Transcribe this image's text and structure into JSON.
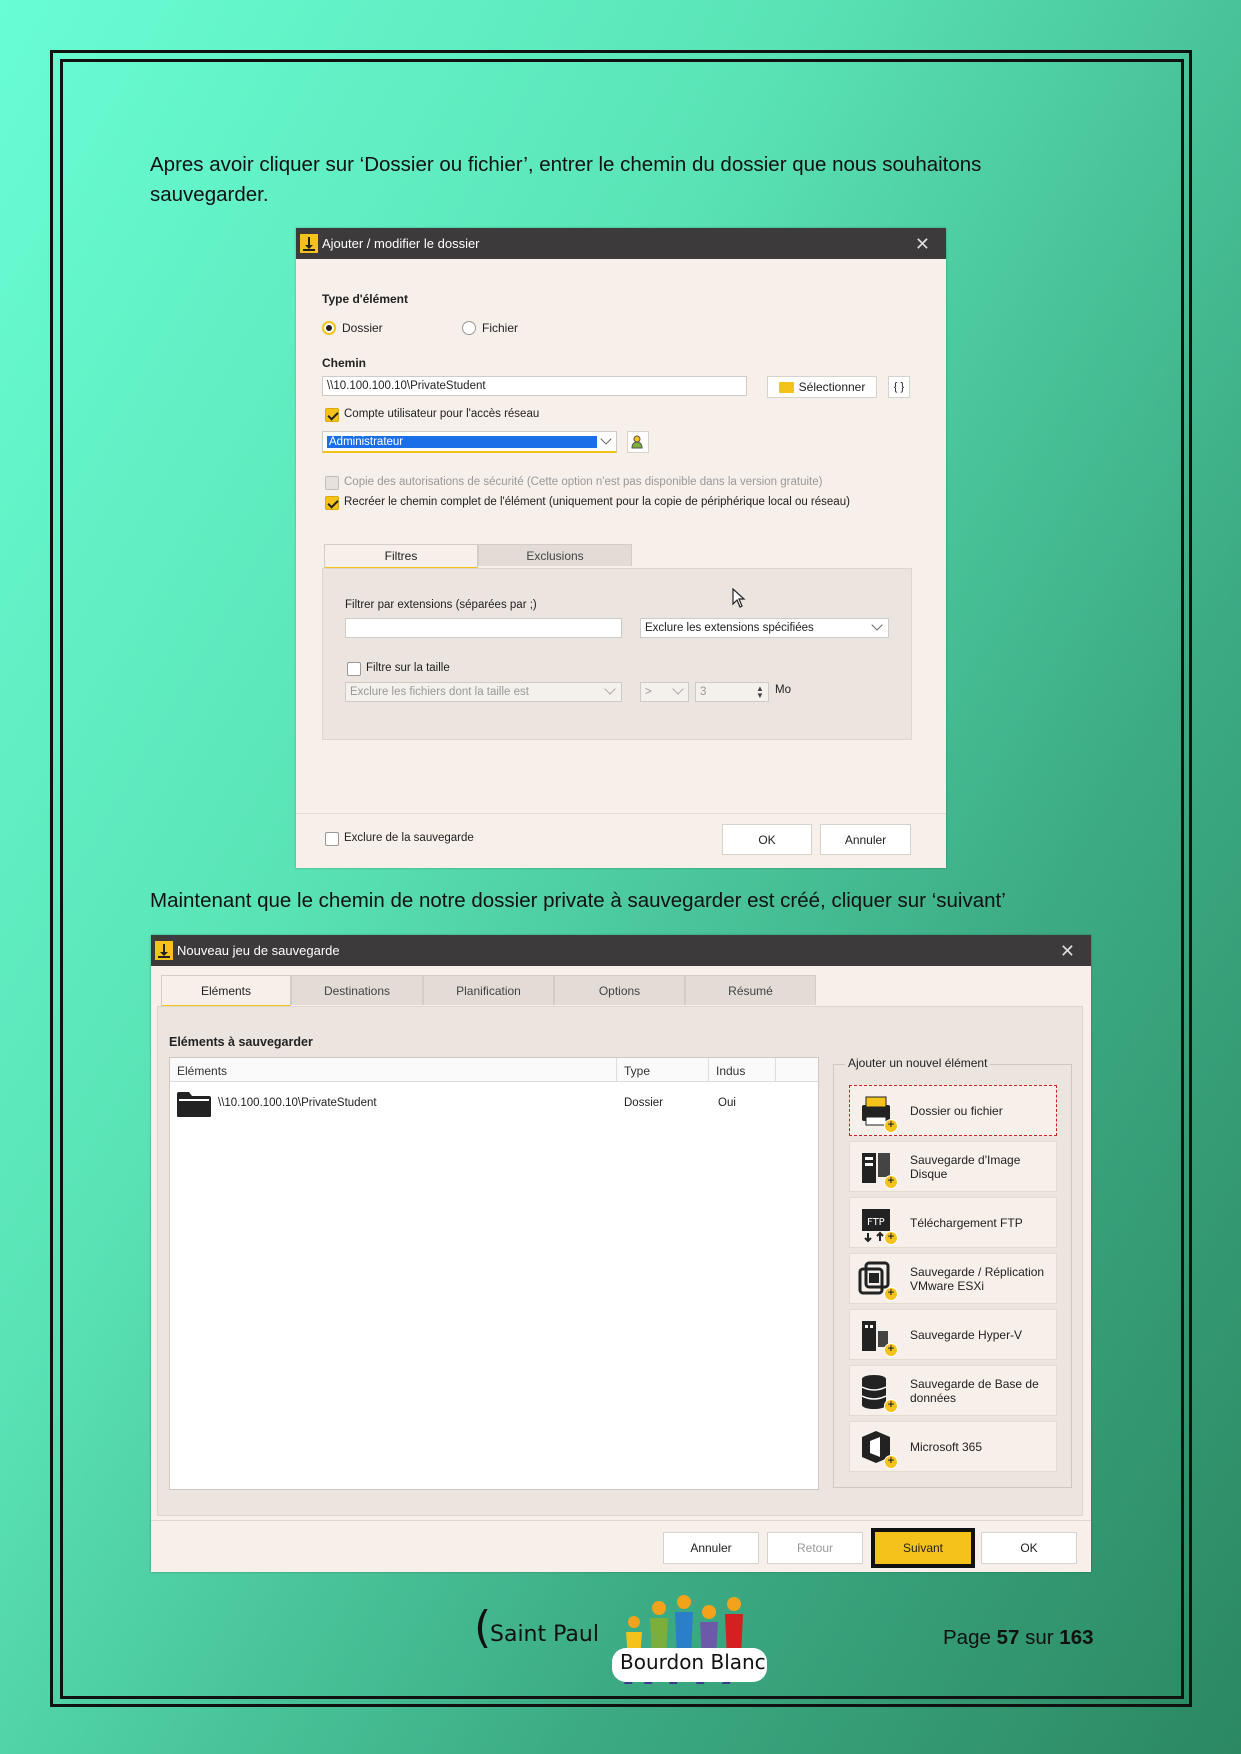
{
  "intro_text": "Apres avoir cliquer sur ‘Dossier ou fichier’, entrer le chemin du dossier que nous souhaitons sauvegarder.",
  "middle_text": "Maintenant que le chemin de notre dossier private à sauvegarder est créé, cliquer sur ‘suivant’",
  "dialog1": {
    "title": "Ajouter / modifier le dossier",
    "type_label": "Type d'élément",
    "radio_dossier": "Dossier",
    "radio_fichier": "Fichier",
    "selected_type": "Dossier",
    "path_label": "Chemin",
    "path_value": "\\\\10.100.100.10\\PrivateStudent",
    "select_button": "Sélectionner",
    "braces_button": "{ }",
    "network_account_label": "Compte utilisateur pour l'accès réseau",
    "network_account_checked": true,
    "account_value": "Administrateur",
    "copy_permissions_label": "Copie des autorisations de sécurité (Cette option n'est pas disponible dans la version gratuite)",
    "recreate_path_label": "Recréer le chemin complet de l'élément (uniquement pour la copie de périphérique local ou réseau)",
    "recreate_path_checked": true,
    "tabs": [
      "Filtres",
      "Exclusions"
    ],
    "filter_ext_label": "Filtrer par extensions (séparées par ;)",
    "filter_ext_value": "",
    "filter_mode": "Exclure les extensions spécifiées",
    "size_filter_label": "Filtre sur la taille",
    "size_mode": "Exclure les fichiers dont la taille est",
    "size_operator": ">",
    "size_value": "3",
    "size_unit": "Mo",
    "exclude_label": "Exclure de la sauvegarde",
    "ok_button": "OK",
    "cancel_button": "Annuler"
  },
  "dialog2": {
    "title": "Nouveau jeu de sauvegarde",
    "tabs": [
      "Eléments",
      "Destinations",
      "Planification",
      "Options",
      "Résumé"
    ],
    "section_title": "Eléments à sauvegarder",
    "columns": [
      "Eléments",
      "Type",
      "Indus"
    ],
    "rows": [
      {
        "path": "\\\\10.100.100.10\\PrivateStudent",
        "type": "Dossier",
        "included": "Oui"
      }
    ],
    "add_group_label": "Ajouter un nouvel élément",
    "add_items": [
      {
        "label": "Dossier ou fichier",
        "icon": "printer-folder-icon"
      },
      {
        "label": "Sauvegarde d'Image Disque",
        "icon": "disk-image-icon"
      },
      {
        "label": "Téléchargement FTP",
        "icon": "ftp-icon"
      },
      {
        "label": "Sauvegarde / Réplication VMware ESXi",
        "icon": "vmware-icon"
      },
      {
        "label": "Sauvegarde Hyper-V",
        "icon": "hyperv-icon"
      },
      {
        "label": "Sauvegarde de Base de données",
        "icon": "database-icon"
      },
      {
        "label": "Microsoft 365",
        "icon": "office365-icon"
      }
    ],
    "buttons": {
      "cancel": "Annuler",
      "back": "Retour",
      "next": "Suivant",
      "ok": "OK"
    }
  },
  "footer": {
    "logo_line1": "Saint Paul",
    "logo_line2": "Bourdon Blanc",
    "page_prefix": "Page",
    "page_current": "57",
    "page_sep": "sur",
    "page_total": "163"
  },
  "colors": {
    "accent": "#f5c21b",
    "titlebar": "#3c3a3a",
    "dialog_bg": "#f6efea",
    "page_gradient_start": "#69fdd4",
    "page_gradient_end": "#2b8862"
  }
}
